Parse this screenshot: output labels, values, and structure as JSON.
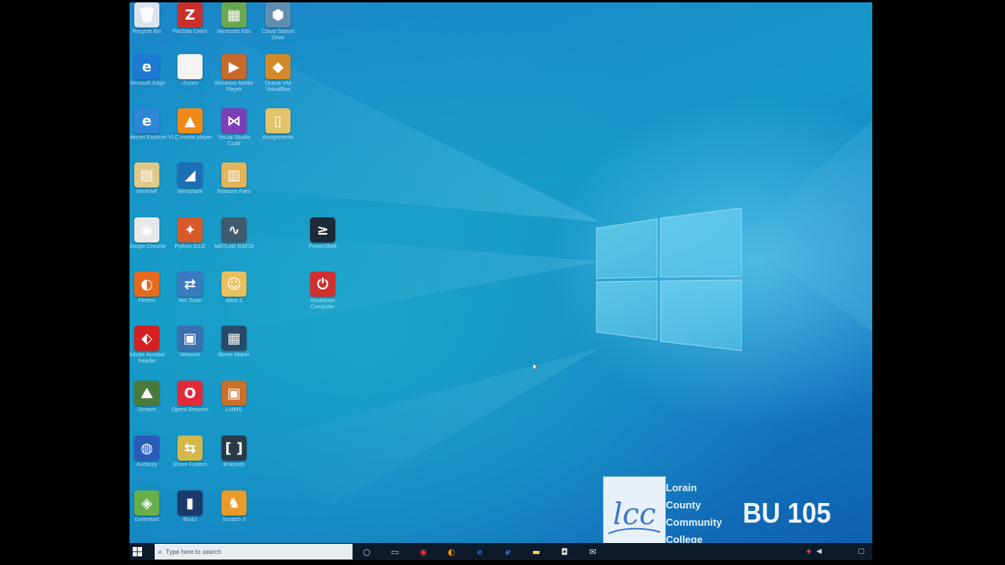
{
  "desktop": {
    "icons": [
      {
        "name": "recycle-bin-icon",
        "label": "Recycle Bin",
        "color": "#d9e4ee",
        "glyph": "🗑"
      },
      {
        "name": "filezilla-icon",
        "label": "FileZilla Client",
        "color": "#c9302c",
        "glyph": "Z"
      },
      {
        "name": "minecraft-icon",
        "label": "Minecraft Edu",
        "color": "#6aa84f",
        "glyph": "▦"
      },
      {
        "name": "cloud-app-icon",
        "label": "Cloud Station Drive",
        "color": "#5f8fb0",
        "glyph": "⬢"
      },
      {
        "name": "edge-icon",
        "label": "Microsoft Edge",
        "color": "#1e78d4",
        "glyph": "e"
      },
      {
        "name": "itunes-icon",
        "label": "iTunes",
        "color": "#f3f3f3",
        "glyph": "♪"
      },
      {
        "name": "media-player-icon",
        "label": "Windows Media Player",
        "color": "#c8692c",
        "glyph": "▶"
      },
      {
        "name": "package-icon",
        "label": "Oracle VM VirtualBox",
        "color": "#d48a2b",
        "glyph": "◆"
      },
      {
        "name": "internet-explorer-icon",
        "label": "Internet Explorer",
        "color": "#2e86d6",
        "glyph": "e"
      },
      {
        "name": "vlc-icon",
        "label": "VLC media player",
        "color": "#f08a18",
        "glyph": "▲"
      },
      {
        "name": "visual-studio-icon",
        "label": "Visual Studio Code",
        "color": "#7c3fb8",
        "glyph": "⋈"
      },
      {
        "name": "folder-icon",
        "label": "Assignments",
        "color": "#e2c36a",
        "glyph": "▯"
      },
      {
        "name": "archive-icon",
        "label": "WinRAR",
        "color": "#e0c88a",
        "glyph": "▤"
      },
      {
        "name": "wireshark-icon",
        "label": "Wireshark",
        "color": "#1c6fb5",
        "glyph": "◢"
      },
      {
        "name": "network-folder-icon",
        "label": "Network Files",
        "color": "#e3b45a",
        "glyph": "▥"
      },
      {
        "name": "chrome-icon",
        "label": "Google Chrome",
        "color": "#e8e8e8",
        "glyph": "◉"
      },
      {
        "name": "python-icon",
        "label": "Python IDLE",
        "color": "#d85a2a",
        "glyph": "✦"
      },
      {
        "name": "matlab-icon",
        "label": "MATLAB R2019",
        "color": "#405a70",
        "glyph": "∿"
      },
      {
        "name": "terminal-icon",
        "label": "PowerShell",
        "color": "#1d2a3a",
        "glyph": "≥"
      },
      {
        "name": "firefox-icon",
        "label": "Firefox",
        "color": "#e56a1e",
        "glyph": "◐"
      },
      {
        "name": "network-tool-icon",
        "label": "Net Tools",
        "color": "#3a7ac0",
        "glyph": "⇄"
      },
      {
        "name": "character-icon",
        "label": "Alice 3",
        "color": "#e8c060",
        "glyph": "☺"
      },
      {
        "name": "shutdown-icon",
        "label": "Shutdown Computer",
        "color": "#d03030",
        "glyph": "⏻"
      },
      {
        "name": "acrobat-icon",
        "label": "Adobe Acrobat Reader",
        "color": "#d42020",
        "glyph": "⬖"
      },
      {
        "name": "network-computers-icon",
        "label": "Network",
        "color": "#3a6fb0",
        "glyph": "▣"
      },
      {
        "name": "movie-maker-icon",
        "label": "Movie Maker",
        "color": "#2a4a6a",
        "glyph": "▦"
      },
      {
        "name": "landscape-app-icon",
        "label": "Scratch",
        "color": "#4a7a3a",
        "glyph": "⛰"
      },
      {
        "name": "opera-icon",
        "label": "Opera Browser",
        "color": "#e02a3a",
        "glyph": "O"
      },
      {
        "name": "record-app-icon",
        "label": "LMMS",
        "color": "#c9702a",
        "glyph": "▣"
      },
      {
        "name": "audacity-icon",
        "label": "Audacity",
        "color": "#2a5ab8",
        "glyph": "◍"
      },
      {
        "name": "network-share-icon",
        "label": "Share Folders",
        "color": "#d4b84a",
        "glyph": "⇆"
      },
      {
        "name": "brackets-icon",
        "label": "Brackets",
        "color": "#2a3a4a",
        "glyph": "[ ]"
      },
      {
        "name": "greenfoot-icon",
        "label": "Greenfoot",
        "color": "#6ab04a",
        "glyph": "◈"
      },
      {
        "name": "bluej-icon",
        "label": "BlueJ",
        "color": "#1a3a6a",
        "glyph": "▮"
      },
      {
        "name": "scratch-cat-icon",
        "label": "Scratch 3",
        "color": "#e89a2a",
        "glyph": "♞"
      }
    ]
  },
  "taskbar": {
    "search_placeholder": "Type here to search",
    "pinned": [
      "task-view-icon",
      "chrome-icon",
      "firefox-icon",
      "edge-icon",
      "ie-icon",
      "file-explorer-icon",
      "store-icon",
      "mail-icon"
    ]
  },
  "watermark": {
    "logo_text": "lcc",
    "college_lines": [
      "Lorain",
      "County",
      "Community",
      "College"
    ],
    "room": "BU 105"
  },
  "colors": {
    "desktop_blue": "#1596c8",
    "taskbar": "#0c1a2a",
    "windows_logo": "#7fd8f0"
  }
}
